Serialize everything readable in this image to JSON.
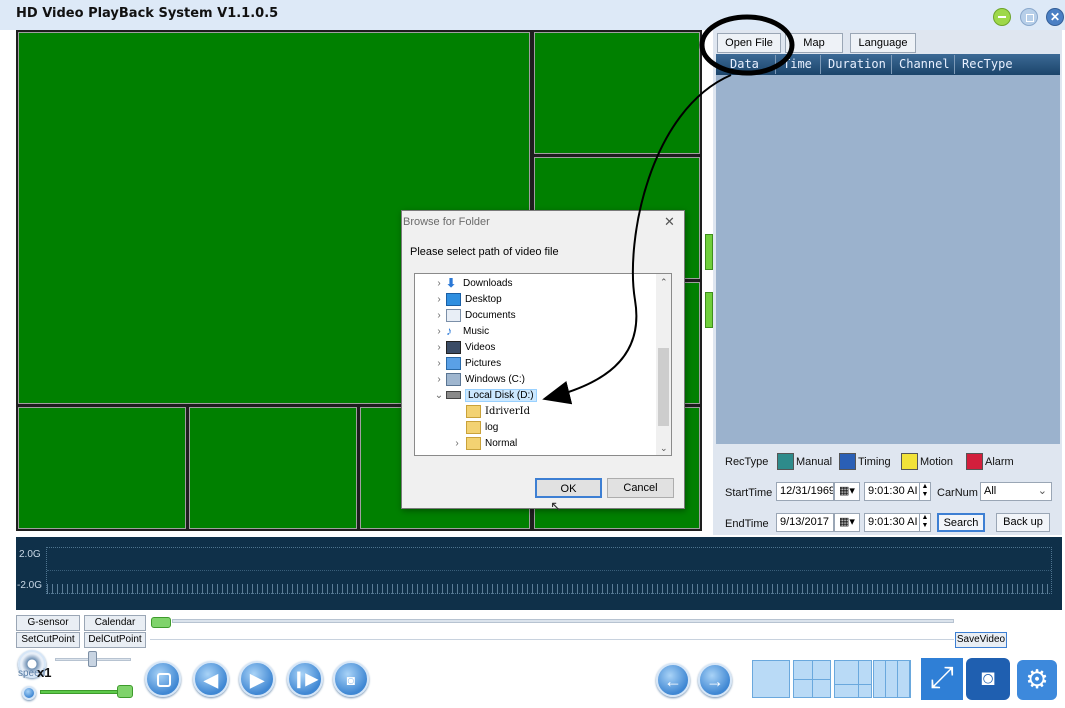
{
  "window": {
    "title": "HD Video PlayBack System V1.1.0.5",
    "close_glyph": "✕"
  },
  "tabs": [
    "Open File",
    "Map",
    "Language"
  ],
  "record_table": {
    "columns": [
      "Data",
      "Time",
      "Duration",
      "Channel",
      "RecType"
    ]
  },
  "filters": {
    "rectype_label": "RecType",
    "rectypes": [
      {
        "label": "Manual",
        "color": "#2e8b8b"
      },
      {
        "label": "Timing",
        "color": "#2a5fb5"
      },
      {
        "label": "Motion",
        "color": "#f2e238"
      },
      {
        "label": "Alarm",
        "color": "#d21f3c"
      }
    ],
    "start_label": "StartTime",
    "start_date": "12/31/1969",
    "start_time": "9:01:30 AI",
    "carnum_label": "CarNum",
    "carnum_value": "All",
    "end_label": "EndTime",
    "end_date": "9/13/2017",
    "end_time": "9:01:30 AI",
    "search_label": "Search",
    "backup_label": "Back up"
  },
  "gsensor": {
    "top_label": "2.0G",
    "bottom_label": "-2.0G"
  },
  "controls": {
    "gsensor_btn": "G-sensor",
    "calendar_btn": "Calendar",
    "setcut_btn": "SetCutPoint",
    "delcut_btn": "DelCutPoint",
    "savevideo_btn": "SaveVideo",
    "speed_label": "speed",
    "speed_value": "x1"
  },
  "dialog": {
    "title": "Browse for Folder",
    "close_glyph": "✕",
    "prompt": "Please select path of video file",
    "tree": [
      {
        "label": "Downloads",
        "chevron": "›",
        "icon": "download-icon"
      },
      {
        "label": "Desktop",
        "chevron": "›",
        "icon": "desktop-icon"
      },
      {
        "label": "Documents",
        "chevron": "›",
        "icon": "documents-icon"
      },
      {
        "label": "Music",
        "chevron": "›",
        "icon": "music-icon"
      },
      {
        "label": "Videos",
        "chevron": "›",
        "icon": "videos-icon"
      },
      {
        "label": "Pictures",
        "chevron": "›",
        "icon": "pictures-icon"
      },
      {
        "label": "Windows (C:)",
        "chevron": "›",
        "icon": "drive-c-icon"
      },
      {
        "label": "Local Disk (D:)",
        "chevron": "⌄",
        "icon": "drive-d-icon",
        "selected": true
      },
      {
        "label": "IdriverId",
        "chevron": "",
        "icon": "folder-icon"
      },
      {
        "label": "log",
        "chevron": "",
        "icon": "folder-icon"
      },
      {
        "label": "Normal",
        "chevron": "›",
        "icon": "folder-icon"
      }
    ],
    "ok_label": "OK",
    "cancel_label": "Cancel"
  }
}
